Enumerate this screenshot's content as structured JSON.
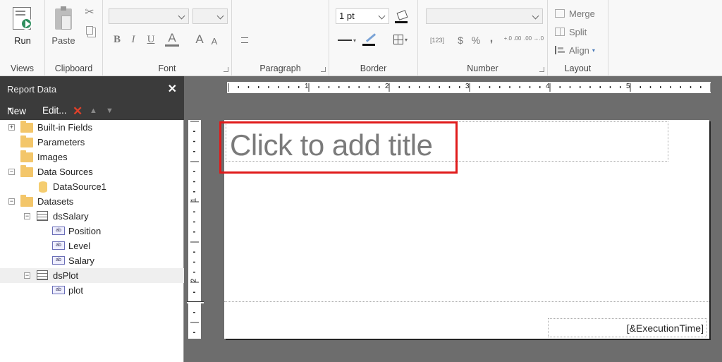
{
  "ribbon": {
    "views": {
      "run_label": "Run",
      "group_label": "Views"
    },
    "clipboard": {
      "paste_label": "Paste",
      "group_label": "Clipboard"
    },
    "font": {
      "group_label": "Font",
      "bold": "B",
      "italic": "I",
      "underline": "U",
      "font_color": "A",
      "grow": "A",
      "shrink": "A"
    },
    "paragraph": {
      "group_label": "Paragraph"
    },
    "border": {
      "group_label": "Border",
      "width_value": "1 pt"
    },
    "number": {
      "group_label": "Number",
      "placeholders_icon": "[123]",
      "currency": "$",
      "percent": "%",
      "comma": ",",
      "inc_decimal": "+.0 .00",
      "dec_decimal": ".00 →.0"
    },
    "layout": {
      "group_label": "Layout",
      "merge_label": "Merge",
      "split_label": "Split",
      "align_label": "Align"
    }
  },
  "report_data": {
    "title": "Report Data",
    "close": "✕",
    "toolbar": {
      "new_label": "New",
      "edit_label": "Edit..."
    },
    "tree": [
      {
        "label": "Built-in Fields"
      },
      {
        "label": "Parameters"
      },
      {
        "label": "Images"
      },
      {
        "label": "Data Sources"
      },
      {
        "label": "DataSource1"
      },
      {
        "label": "Datasets"
      },
      {
        "label": "dsSalary"
      },
      {
        "label": "Position"
      },
      {
        "label": "Level"
      },
      {
        "label": "Salary"
      },
      {
        "label": "dsPlot"
      },
      {
        "label": "plot"
      }
    ]
  },
  "design": {
    "title_placeholder": "Click to add title",
    "execution_time": "[&ExecutionTime]",
    "ruler_numbers": [
      "1",
      "2",
      "3",
      "4",
      "5"
    ],
    "vruler_numbers": [
      "1",
      "2"
    ]
  }
}
